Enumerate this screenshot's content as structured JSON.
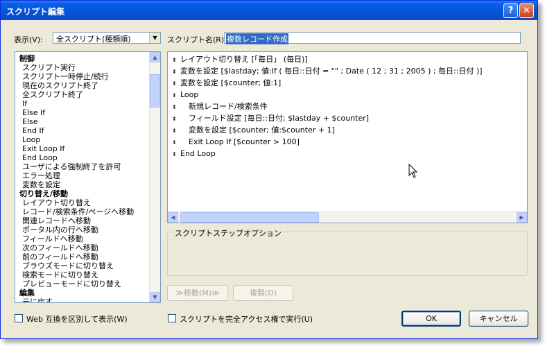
{
  "window": {
    "title": "スクリプト編集"
  },
  "titlebar": {
    "help_icon": "?",
    "close_icon": "✕"
  },
  "display": {
    "label": "表示(V):",
    "selected": "全スクリプト(種類順)"
  },
  "script_name": {
    "label": "スクリプト名(R):",
    "value": "複数レコード作成"
  },
  "step_list": [
    {
      "label": "制御",
      "category": true
    },
    {
      "label": "スクリプト実行"
    },
    {
      "label": "スクリプト一時停止/続行"
    },
    {
      "label": "現在のスクリプト終了"
    },
    {
      "label": "全スクリプト終了"
    },
    {
      "label": "If"
    },
    {
      "label": "Else If"
    },
    {
      "label": "Else"
    },
    {
      "label": "End If"
    },
    {
      "label": "Loop"
    },
    {
      "label": "Exit Loop If"
    },
    {
      "label": "End Loop"
    },
    {
      "label": "ユーザによる強制終了を許可"
    },
    {
      "label": "エラー処理"
    },
    {
      "label": "変数を設定"
    },
    {
      "label": "切り替え/移動",
      "category": true
    },
    {
      "label": "レイアウト切り替え"
    },
    {
      "label": "レコード/検索条件/ページへ移動"
    },
    {
      "label": "関連レコードへ移動"
    },
    {
      "label": "ポータル内の行へ移動"
    },
    {
      "label": "フィールドへ移動"
    },
    {
      "label": "次のフィールドへ移動"
    },
    {
      "label": "前のフィールドへ移動"
    },
    {
      "label": "ブラウズモードに切り替え"
    },
    {
      "label": "検索モードに切り替え"
    },
    {
      "label": "プレビューモードに切り替え"
    },
    {
      "label": "編集",
      "category": true
    },
    {
      "label": "元に戻す"
    }
  ],
  "script_steps": [
    {
      "text": "レイアウト切り替え [「毎日」 (毎日)]",
      "indent": 0
    },
    {
      "text": "変数を設定 [$lastday; 値:If ( 毎日::日付 = \"\" ; Date ( 12 ; 31 ; 2005 ) ; 毎日::日付 )]",
      "indent": 0
    },
    {
      "text": "変数を設定 [$counter; 値:1]",
      "indent": 0
    },
    {
      "text": "Loop",
      "indent": 0
    },
    {
      "text": "新規レコード/検索条件",
      "indent": 1
    },
    {
      "text": "フィールド設定 [毎日::日付; $lastday + $counter]",
      "indent": 1
    },
    {
      "text": "変数を設定 [$counter; 値:$counter + 1]",
      "indent": 1
    },
    {
      "text": "Exit Loop If [$counter > 100]",
      "indent": 1
    },
    {
      "text": "End Loop",
      "indent": 0
    }
  ],
  "options": {
    "legend": "スクリプトステップオプション"
  },
  "buttons": {
    "move": "≫移動(M)≫",
    "duplicate": "複製(D)",
    "ok": "OK",
    "cancel": "キャンセル"
  },
  "checkboxes": {
    "web_compat": "Web 互換を区別して表示(W)",
    "full_access": "スクリプトを完全アクセス権で実行(U)"
  },
  "scroll_icons": {
    "up": "▲",
    "down": "▼",
    "left": "◀",
    "right": "▶"
  },
  "step_handle_icon": "⬍",
  "colors": {
    "title_bar": "#0553d8",
    "selection": "#316ac5",
    "face": "#ece9d8"
  }
}
